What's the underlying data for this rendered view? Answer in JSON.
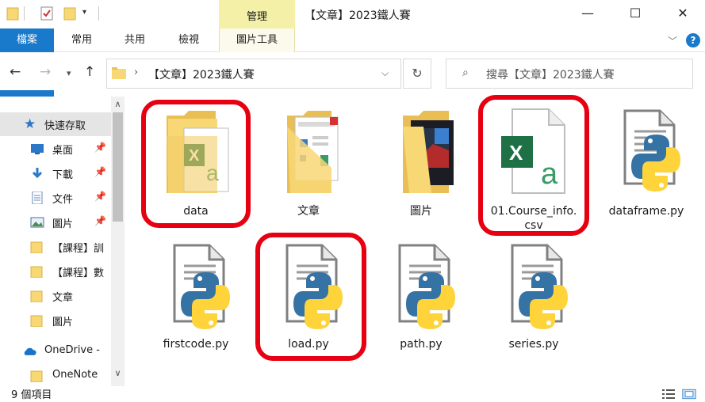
{
  "window": {
    "title": "【文章】2023鐵人賽",
    "context_group": "管理",
    "minimize": "—",
    "maximize": "☐",
    "close": "✕"
  },
  "ribbon": {
    "tabs": [
      "檔案",
      "常用",
      "共用",
      "檢視",
      "圖片工具"
    ],
    "help": "?"
  },
  "address": {
    "path": "【文章】2023鐵人賽",
    "search_placeholder": "搜尋【文章】2023鐵人賽"
  },
  "navpane": {
    "items": [
      {
        "label": "快速存取",
        "icon": "star-icon"
      },
      {
        "label": "桌面",
        "icon": "desktop-icon"
      },
      {
        "label": "下載",
        "icon": "download-icon"
      },
      {
        "label": "文件",
        "icon": "document-icon"
      },
      {
        "label": "圖片",
        "icon": "picture-icon"
      },
      {
        "label": "【課程】訓",
        "icon": "folder-icon"
      },
      {
        "label": "【課程】數",
        "icon": "folder-icon"
      },
      {
        "label": "文章",
        "icon": "folder-icon"
      },
      {
        "label": "圖片",
        "icon": "folder-icon"
      },
      {
        "label": "OneDrive -",
        "icon": "cloud-icon"
      },
      {
        "label": "OneNote",
        "icon": "folder-icon"
      }
    ]
  },
  "files": [
    {
      "label": "data",
      "icon": "folder-excel-icon"
    },
    {
      "label": "文章",
      "icon": "folder-docs-icon"
    },
    {
      "label": "圖片",
      "icon": "folder-images-icon"
    },
    {
      "label": "01.Course_info.csv",
      "icon": "csv-file-icon"
    },
    {
      "label": "dataframe.py",
      "icon": "python-file-icon"
    },
    {
      "label": "firstcode.py",
      "icon": "python-file-icon"
    },
    {
      "label": "load.py",
      "icon": "python-file-icon"
    },
    {
      "label": "path.py",
      "icon": "python-file-icon"
    },
    {
      "label": "series.py",
      "icon": "python-file-icon"
    }
  ],
  "status": {
    "count": "9 個項目"
  },
  "colors": {
    "accent": "#1979ca",
    "highlight": "#e60012",
    "context_tab": "#f4f0a8",
    "folder": "#f8d775",
    "excel": "#1e7145",
    "python_blue": "#3673a5",
    "python_yellow": "#ffd43b"
  }
}
